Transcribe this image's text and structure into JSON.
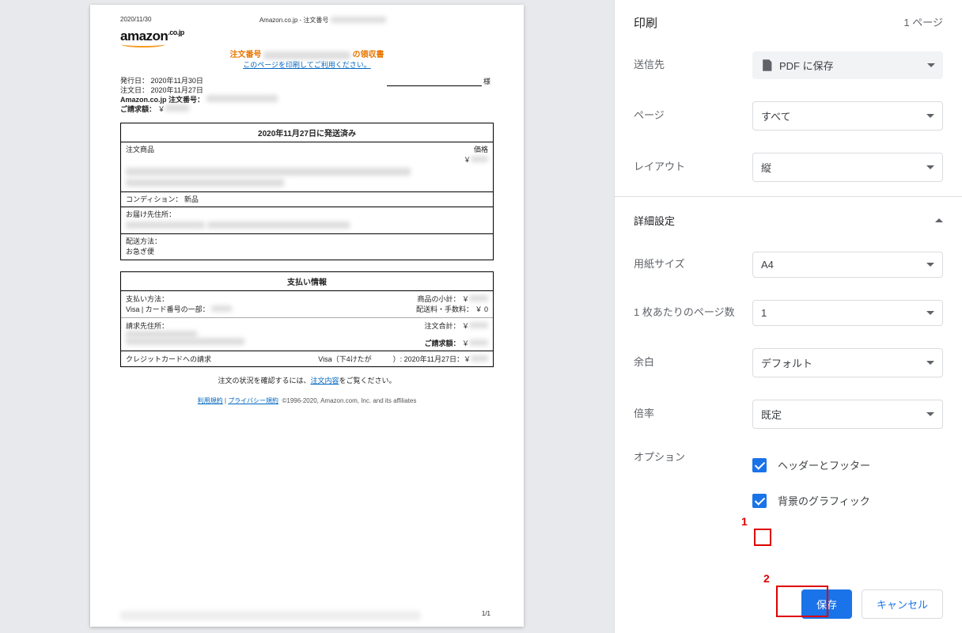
{
  "preview": {
    "date_header": "2020/11/30",
    "title_header": "Amazon.co.jp - 注文番号",
    "logo_main": "amazon",
    "logo_sub": ".co.jp",
    "order_prefix": "注文番号",
    "order_suffix": "の領収書",
    "print_link": "このページを印刷してご利用ください。",
    "issue_date": "発行日： 2020年11月30日",
    "order_date": "注文日： 2020年11月27日",
    "order_no_label": "Amazon.co.jp 注文番号：",
    "total_label": "ご請求額：",
    "currency": "￥",
    "sama": "様",
    "ship_header": "2020年11月27日に発送済み",
    "item_hdr_left": "注文商品",
    "item_hdr_right": "価格",
    "condition": "コンディション： 新品",
    "address_label": "お届け先住所：",
    "ship_method_label": "配送方法：",
    "ship_method": "お急ぎ便",
    "pay_header": "支払い情報",
    "pay_method_label": "支払い方法：",
    "pay_method": "Visa | カード番号の一部：",
    "bill_address_label": "請求先住所：",
    "subtotal_label": "商品の小計：",
    "shipping_label": "配送料・手数料：",
    "shipping_value": "￥ 0",
    "order_total_label": "注文合計：",
    "grand_total_label": "ご請求額：",
    "cc_charge_label": "クレジットカードへの請求",
    "cc_charge_value": "Visa（下4けたが　　　）: 2020年11月27日：￥",
    "status_note_pre": "注文の状況を確認するには、",
    "status_note_link": "注文内容",
    "status_note_post": "をご覧ください。",
    "terms_link": "利用規約",
    "privacy_link": "プライバシー規約",
    "copyright": "©1996-2020, Amazon.com, Inc. and its affiliates",
    "page_num": "1/1"
  },
  "panel": {
    "title": "印刷",
    "page_count": "1 ページ",
    "dest_label": "送信先",
    "dest_value": "PDF に保存",
    "pages_label": "ページ",
    "pages_value": "すべて",
    "layout_label": "レイアウト",
    "layout_value": "縦",
    "advanced": "詳細設定",
    "paper_label": "用紙サイズ",
    "paper_value": "A4",
    "persheet_label": "1 枚あたりのページ数",
    "persheet_value": "1",
    "margin_label": "余白",
    "margin_value": "デフォルト",
    "scale_label": "倍率",
    "scale_value": "既定",
    "options_label": "オプション",
    "option1": "ヘッダーとフッター",
    "option2": "背景のグラフィック",
    "save": "保存",
    "cancel": "キャンセル"
  },
  "annotations": {
    "a1": "1",
    "a2": "2"
  }
}
